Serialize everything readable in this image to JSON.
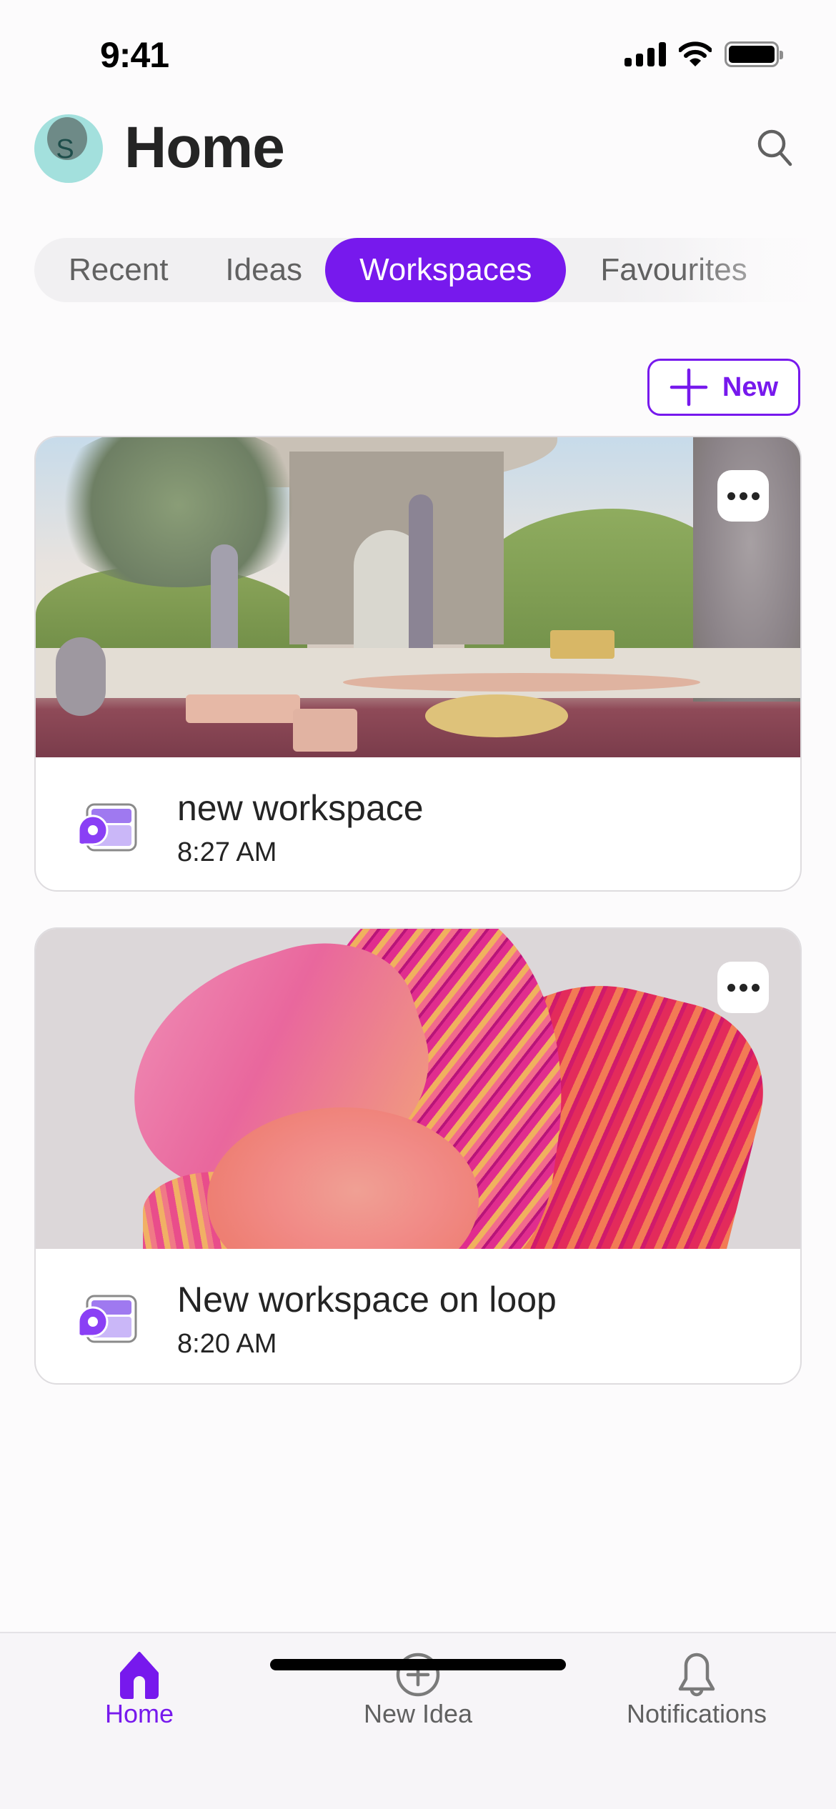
{
  "status_bar": {
    "time": "9:41",
    "icons": [
      "cellular-signal-icon",
      "wifi-icon",
      "battery-icon"
    ]
  },
  "header": {
    "avatar_initial": "S",
    "title": "Home",
    "search_icon": "search-icon"
  },
  "tabs": [
    {
      "label": "Recent",
      "active": false
    },
    {
      "label": "Ideas",
      "active": false
    },
    {
      "label": "Workspaces",
      "active": true
    },
    {
      "label": "Favourites",
      "active": false
    }
  ],
  "new_button": {
    "label": "New",
    "icon": "plus-icon"
  },
  "workspaces": [
    {
      "title": "new workspace",
      "time": "8:27 AM",
      "image": "garden-patio-scene",
      "icon": "loop-workspace-icon",
      "more_icon": "more-horizontal-icon"
    },
    {
      "title": "New workspace on loop",
      "time": "8:20 AM",
      "image": "pink-swirl-abstract",
      "icon": "loop-workspace-icon",
      "more_icon": "more-horizontal-icon"
    }
  ],
  "bottom_nav": [
    {
      "label": "Home",
      "icon": "home-icon",
      "active": true
    },
    {
      "label": "New Idea",
      "icon": "add-circle-icon",
      "active": false
    },
    {
      "label": "Notifications",
      "icon": "bell-icon",
      "active": false
    }
  ],
  "colors": {
    "accent": "#7719ed",
    "text_primary": "#242424",
    "text_secondary": "#616161",
    "avatar_bg": "#a3e0dd",
    "tab_bg": "#f1f0f2",
    "card_border": "#dedcdf"
  }
}
